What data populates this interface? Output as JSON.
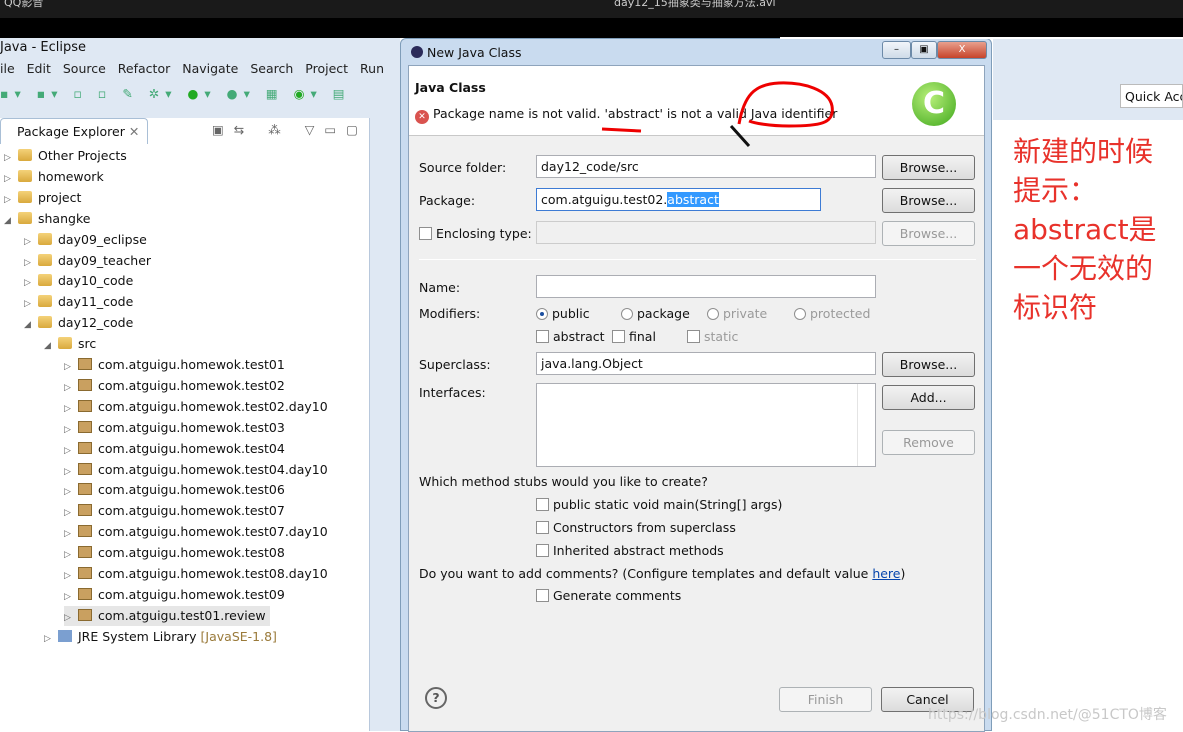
{
  "player": {
    "app_title": "QQ影音",
    "file_title": "day12_15抽象类与抽象方法.avi"
  },
  "eclipse": {
    "title": "Java - Eclipse",
    "menu": [
      "ile",
      "Edit",
      "Source",
      "Refactor",
      "Navigate",
      "Search",
      "Project",
      "Run"
    ],
    "quick_access": "Quick Acc"
  },
  "package_explorer": {
    "tab": "Package Explorer",
    "items": [
      {
        "label": "Other Projects",
        "level": 0,
        "type": "project",
        "expanded": false
      },
      {
        "label": "homework",
        "level": 0,
        "type": "project",
        "expanded": false
      },
      {
        "label": "project",
        "level": 0,
        "type": "project",
        "expanded": false
      },
      {
        "label": "shangke",
        "level": 0,
        "type": "project",
        "expanded": true
      },
      {
        "label": "day09_eclipse",
        "level": 1,
        "type": "project",
        "expanded": false
      },
      {
        "label": "day09_teacher",
        "level": 1,
        "type": "project",
        "expanded": false
      },
      {
        "label": "day10_code",
        "level": 1,
        "type": "project",
        "expanded": false
      },
      {
        "label": "day11_code",
        "level": 1,
        "type": "project",
        "expanded": false
      },
      {
        "label": "day12_code",
        "level": 1,
        "type": "project",
        "expanded": true
      },
      {
        "label": "src",
        "level": 2,
        "type": "src",
        "expanded": true
      },
      {
        "label": "com.atguigu.homewok.test01",
        "level": 3,
        "type": "package"
      },
      {
        "label": "com.atguigu.homewok.test02",
        "level": 3,
        "type": "package"
      },
      {
        "label": "com.atguigu.homewok.test02.day10",
        "level": 3,
        "type": "package"
      },
      {
        "label": "com.atguigu.homewok.test03",
        "level": 3,
        "type": "package"
      },
      {
        "label": "com.atguigu.homewok.test04",
        "level": 3,
        "type": "package"
      },
      {
        "label": "com.atguigu.homewok.test04.day10",
        "level": 3,
        "type": "package"
      },
      {
        "label": "com.atguigu.homewok.test06",
        "level": 3,
        "type": "package"
      },
      {
        "label": "com.atguigu.homewok.test07",
        "level": 3,
        "type": "package"
      },
      {
        "label": "com.atguigu.homewok.test07.day10",
        "level": 3,
        "type": "package"
      },
      {
        "label": "com.atguigu.homewok.test08",
        "level": 3,
        "type": "package"
      },
      {
        "label": "com.atguigu.homewok.test08.day10",
        "level": 3,
        "type": "package"
      },
      {
        "label": "com.atguigu.homewok.test09",
        "level": 3,
        "type": "package"
      },
      {
        "label": "com.atguigu.test01.review",
        "level": 3,
        "type": "package",
        "selected": true
      },
      {
        "label": "JRE System Library",
        "suffix": "[JavaSE-1.8]",
        "level": 2,
        "type": "library"
      }
    ]
  },
  "dialog": {
    "title": "New Java Class",
    "heading": "Java Class",
    "error": "Package name is not valid. 'abstract' is not a valid Java identifier",
    "source_folder": {
      "label": "Source folder:",
      "value": "day12_code/src",
      "button": "Browse..."
    },
    "package": {
      "label": "Package:",
      "value_prefix": "com.atguigu.test02.",
      "value_selected": "abstract",
      "button": "Browse..."
    },
    "enclosing": {
      "label": "Enclosing type:",
      "button": "Browse..."
    },
    "name": {
      "label": "Name:",
      "value": ""
    },
    "modifiers": {
      "label": "Modifiers:",
      "options": [
        "public",
        "package",
        "private",
        "protected"
      ],
      "selected": "public",
      "checks": [
        "abstract",
        "final",
        "static"
      ]
    },
    "superclass": {
      "label": "Superclass:",
      "value": "java.lang.Object",
      "button": "Browse..."
    },
    "interfaces": {
      "label": "Interfaces:",
      "add": "Add...",
      "remove": "Remove"
    },
    "stubs": {
      "question": "Which method stubs would you like to create?",
      "options": [
        "public static void main(String[] args)",
        "Constructors from superclass",
        "Inherited abstract methods"
      ]
    },
    "comments": {
      "question": "Do you want to add comments? (Configure templates and default value ",
      "link": "here",
      "close": ")",
      "option": "Generate comments"
    },
    "finish": "Finish",
    "cancel": "Cancel"
  },
  "annotation": {
    "lines": [
      "新建的时候",
      "提示：",
      "abstract是",
      "一个无效的",
      "标识符"
    ],
    "color": "#e8322b"
  },
  "watermark": "https://blog.csdn.net/@51CTO博客"
}
